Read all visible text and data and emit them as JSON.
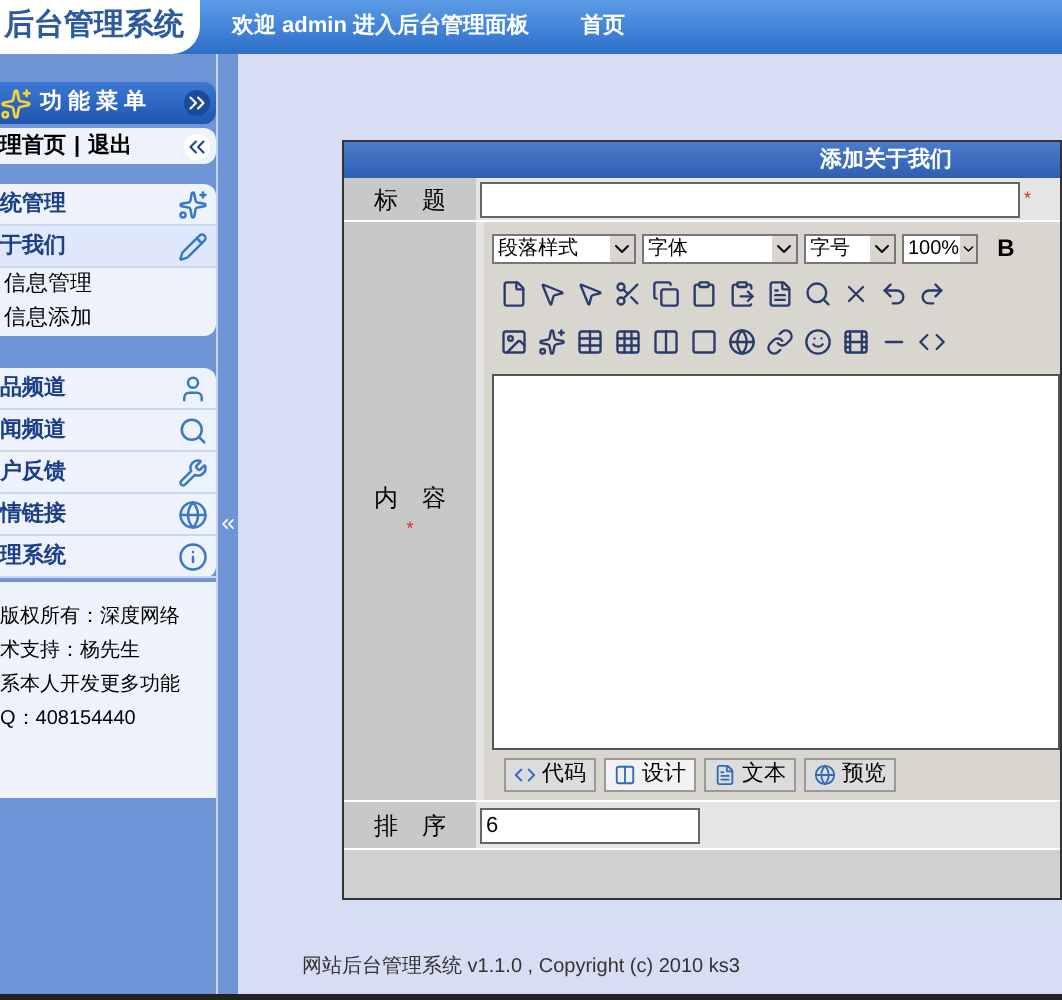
{
  "header": {
    "logo": "后台管理系统",
    "welcome": "欢迎 admin 进入后台管理面板",
    "home_link": "首页"
  },
  "sidebar": {
    "menu_title": "功能菜单",
    "home": "理首页",
    "separator": "|",
    "logout": "退出",
    "groups": [
      {
        "items": [
          {
            "label": "统管理",
            "expanded": false
          },
          {
            "label": "于我们",
            "expanded": true,
            "children": [
              {
                "label": "信息管理"
              },
              {
                "label": "信息添加"
              }
            ]
          }
        ]
      },
      {
        "items": [
          {
            "label": "品频道",
            "expanded": false
          },
          {
            "label": "闻频道",
            "expanded": false
          },
          {
            "label": "户反馈",
            "expanded": false
          },
          {
            "label": "情链接",
            "expanded": false
          },
          {
            "label": "理系统",
            "expanded": false
          }
        ]
      }
    ],
    "info": [
      "版权所有：深度网络",
      "术支持：杨先生",
      "系本人开发更多功能",
      "Q：408154440"
    ]
  },
  "form": {
    "title": "添加关于我们",
    "title_field": {
      "label": "标　题",
      "required_mark": "*"
    },
    "content_field": {
      "label": "内　容",
      "required_mark": "*"
    },
    "editor": {
      "selects": [
        "段落样式",
        "字体",
        "字号",
        "100%"
      ],
      "bold": "B",
      "tabs": [
        {
          "label": "代码",
          "selected": false
        },
        {
          "label": "设计",
          "selected": true
        },
        {
          "label": "文本",
          "selected": false
        },
        {
          "label": "预览",
          "selected": false
        }
      ]
    },
    "sort_field": {
      "label": "排　序",
      "value": "6"
    }
  },
  "footer": "网站后台管理系统 v1.1.0 , Copyright (c) 2010 ks3"
}
